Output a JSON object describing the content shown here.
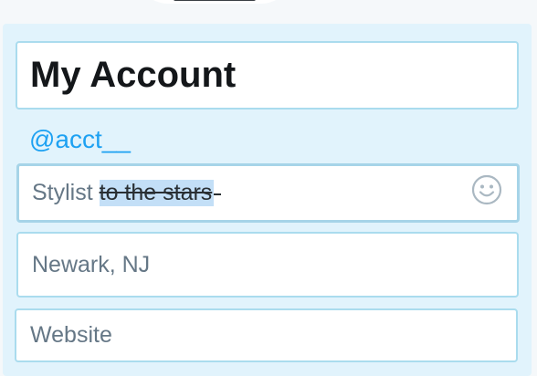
{
  "profile": {
    "name": "My Account",
    "handle": "@acct__",
    "bio": {
      "plain": "Stylist ",
      "struck": "to the stars"
    },
    "location": "Newark, NJ",
    "website": {
      "value": "",
      "placeholder": "Website"
    }
  },
  "icons": {
    "emoji": "smiley-face-icon"
  },
  "colors": {
    "panel_background": "#e1f3fc",
    "field_border": "#aadcee",
    "handle_link": "#1da1f2",
    "selection_highlight": "#c3dff7",
    "placeholder_text": "#657786"
  }
}
